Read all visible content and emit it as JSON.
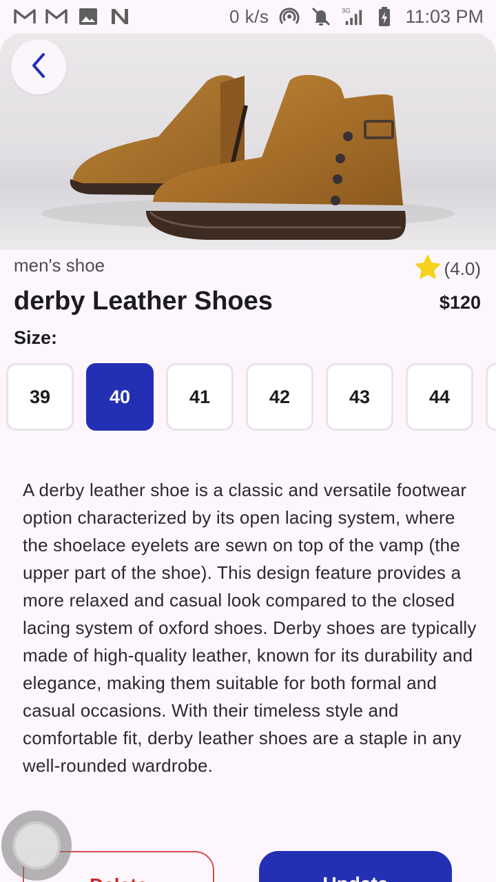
{
  "status_bar": {
    "notification_icons": [
      "gmail-icon",
      "gmail-icon",
      "gallery-icon",
      "n-app-icon"
    ],
    "network_speed": "0 k/s",
    "network_type": "3G",
    "time": "11:03 PM"
  },
  "product": {
    "category": "men's shoe",
    "rating": "(4.0)",
    "title": "derby Leather Shoes",
    "price": "$120",
    "size_label": "Size:",
    "sizes": [
      "39",
      "40",
      "41",
      "42",
      "43",
      "44"
    ],
    "selected_size": "40",
    "description": "A derby leather shoe is a classic and versatile footwear option characterized by its open lacing system, where the shoelace eyelets are sewn on top of the vamp (the upper part of the shoe). This design feature provides a more relaxed and casual look compared to the closed lacing system of oxford shoes. Derby shoes are typically made of high-quality leather, known for its durability and elegance, making them suitable for both formal and casual occasions. With their timeless style and comfortable fit, derby leather shoes are a staple in any well-rounded wardrobe."
  },
  "actions": {
    "delete_label": "Delete",
    "update_label": "Update"
  },
  "colors": {
    "accent": "#2330b4",
    "delete": "#c62828",
    "star": "#f5d21c",
    "background": "#fdf7fd"
  }
}
